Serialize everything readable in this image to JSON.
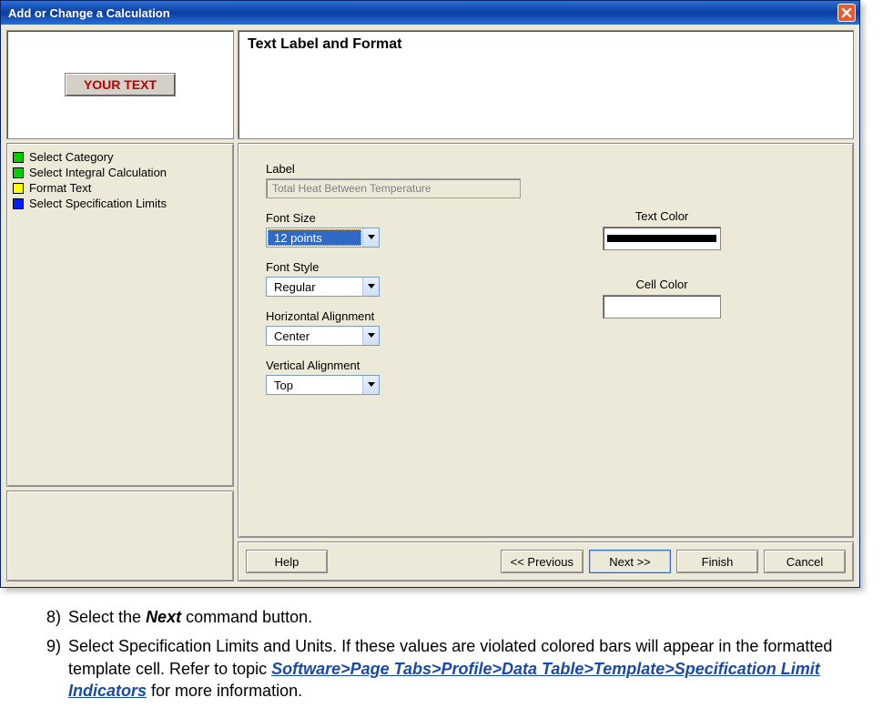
{
  "dialog": {
    "title": "Add or Change a Calculation",
    "preview_text": "YOUR TEXT",
    "steps": [
      {
        "label": "Select Category",
        "color": "#00d000"
      },
      {
        "label": "Select Integral Calculation",
        "color": "#00d000"
      },
      {
        "label": "Format Text",
        "color": "#ffff00"
      },
      {
        "label": "Select Specification Limits",
        "color": "#0020ff"
      }
    ],
    "panel_title": "Text Label and Format",
    "form": {
      "label_caption": "Label",
      "label_value": "Total Heat Between Temperature",
      "fontsize_caption": "Font Size",
      "fontsize_value": "12 points",
      "fontstyle_caption": "Font Style",
      "fontstyle_value": "Regular",
      "halign_caption": "Horizontal Alignment",
      "halign_value": "Center",
      "valign_caption": "Vertical Alignment",
      "valign_value": "Top",
      "textcolor_caption": "Text Color",
      "cellcolor_caption": "Cell Color"
    },
    "buttons": {
      "help": "Help",
      "prev": "<< Previous",
      "next": "Next >>",
      "finish": "Finish",
      "cancel": "Cancel"
    }
  },
  "doc": {
    "item8_num": "8)",
    "item8_a": "Select the ",
    "item8_b": "Next",
    "item8_c": " command button.",
    "item9_num": "9)",
    "item9_a": "Select Specification Limits and Units. If these values are violated colored bars will appear in the formatted template cell. Refer to   topic ",
    "item9_link": "Software>Page Tabs>Profile>Data Table>Template>Specification Limit Indicators",
    "item9_b": " for more information."
  }
}
